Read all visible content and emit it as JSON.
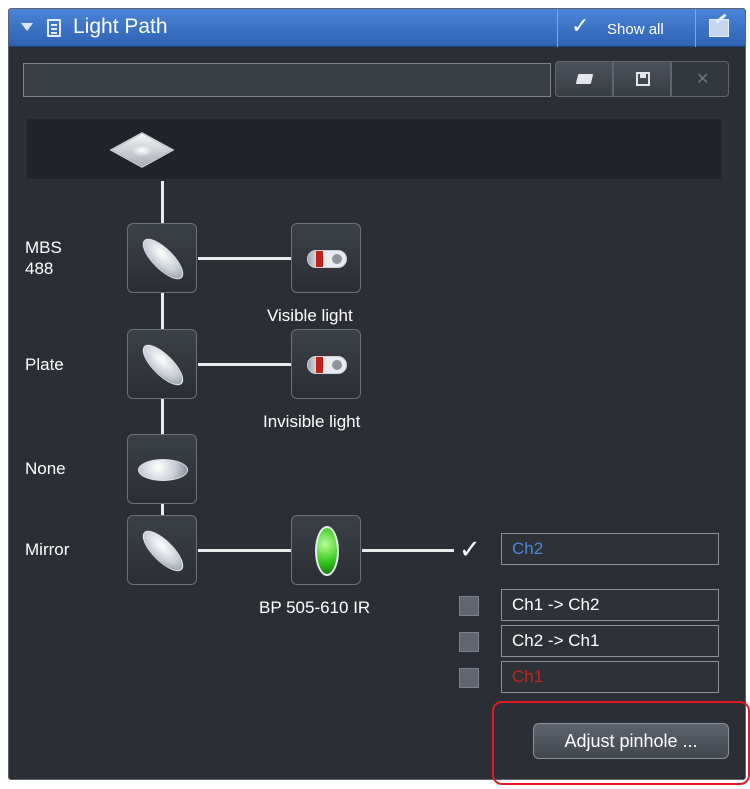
{
  "panel": {
    "title": "Light Path",
    "show_all": "Show all",
    "config_value": ""
  },
  "icons": {
    "collapse": "triangle-down-icon",
    "panel": "document-icon",
    "check": "check-icon",
    "undock": "undock-icon",
    "open": "folder-open-icon",
    "save": "floppy-disk-icon",
    "delete": "close-icon",
    "sample": "sample-stage-icon",
    "detector": "detector-icon"
  },
  "light_path": {
    "elements": [
      {
        "label": "MBS\n488",
        "label_line1": "MBS",
        "label_line2": "488",
        "detector": "Visible light"
      },
      {
        "label": "Plate",
        "detector": "Invisible light"
      },
      {
        "label": "None"
      },
      {
        "label": "Mirror",
        "filter": "BP 505-610 IR"
      }
    ]
  },
  "channels": [
    {
      "label": "Ch2",
      "checked": true,
      "color": "#4f86e0"
    },
    {
      "label": "Ch1 -> Ch2",
      "checked": false,
      "color": "#ffffff"
    },
    {
      "label": "Ch2 -> Ch1",
      "checked": false,
      "color": "#ffffff"
    },
    {
      "label": "Ch1",
      "checked": false,
      "color": "#c3231f"
    }
  ],
  "actions": {
    "adjust_pinhole": "Adjust pinhole ..."
  },
  "colors": {
    "title_bar": "#3b74c8",
    "panel_bg": "#2b2f35",
    "filter_green": "#30c21a",
    "highlight": "#e31b23"
  }
}
